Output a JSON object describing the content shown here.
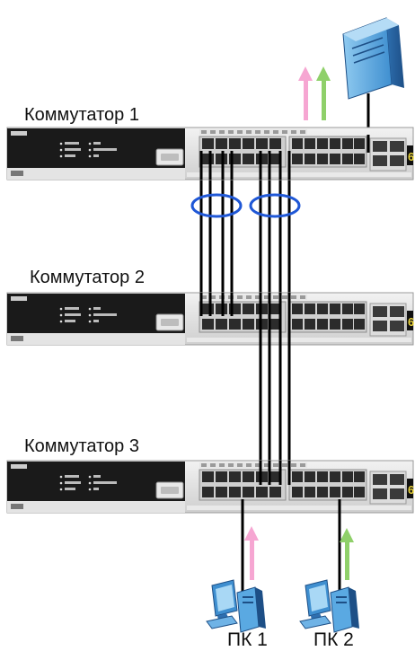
{
  "labels": {
    "switch_1": "Коммутатор 1",
    "switch_2": "Коммутатор 2",
    "switch_3": "Коммутатор 3",
    "pc_1": "ПК 1",
    "pc_2": "ПК 2"
  },
  "switch_panel": {
    "brand": "D-Link",
    "led_legend": [
      "Power",
      "Console",
      "RPS"
    ],
    "port_legend": [
      "1-5",
      "25-1000Fx",
      "1-"
    ]
  },
  "colors": {
    "pc1_traffic": "#f6a6d2",
    "pc2_traffic": "#8fd06a",
    "link_aggregation_ring": "#1f57d6",
    "server_blue": "#5aa9e2",
    "cable": "#000000"
  },
  "icons": [
    "server-icon",
    "pc-icon",
    "switch-icon"
  ]
}
